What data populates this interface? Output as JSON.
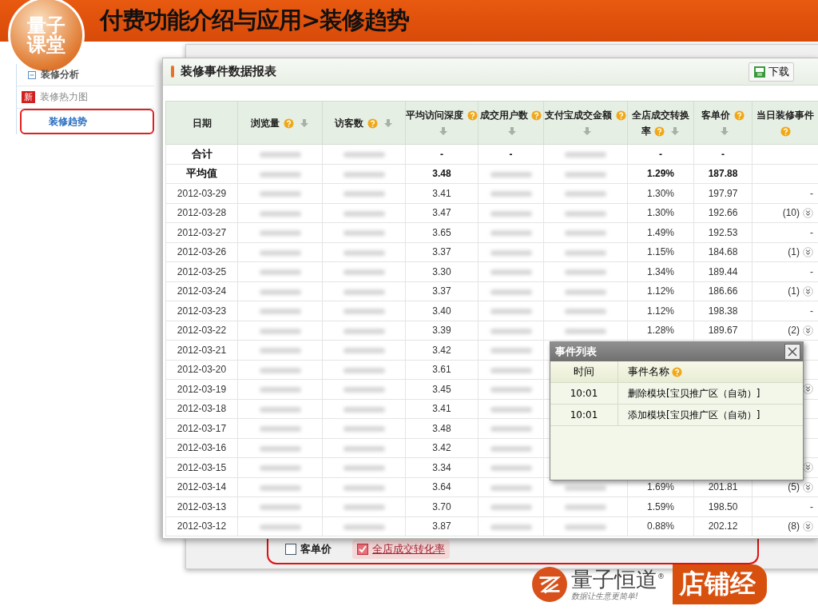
{
  "slide": {
    "title": "付费功能介绍与应用>装修趋势",
    "logo": [
      "量子",
      "课堂"
    ]
  },
  "sidebar": {
    "items": [
      {
        "kind": "group",
        "label": "装修分析",
        "selected": false
      },
      {
        "kind": "new",
        "badge": "新",
        "label": "装修热力图",
        "selected": false
      },
      {
        "kind": "link",
        "label": "装修趋势",
        "selected": true
      }
    ]
  },
  "report": {
    "title": "装修事件数据报表",
    "download": "下载",
    "columns": [
      {
        "label": "日期",
        "help": false,
        "sort": false
      },
      {
        "label": "浏览量",
        "help": true,
        "sort": true
      },
      {
        "label": "访客数",
        "help": true,
        "sort": true
      },
      {
        "label": "平均访问深度",
        "help": true,
        "sort": true
      },
      {
        "label": "成交用户数",
        "help": true,
        "sort": true
      },
      {
        "label": "支付宝成交金额",
        "help": true,
        "sort": true
      },
      {
        "label": "全店成交转换率",
        "help": true,
        "sort": true
      },
      {
        "label": "客单价",
        "help": true,
        "sort": true
      },
      {
        "label": "当日装修事件",
        "help": true,
        "sort": false
      }
    ],
    "rows": [
      {
        "kind": "summary",
        "cells": [
          "合计",
          {
            "kind": "blurred"
          },
          {
            "kind": "blurred"
          },
          "-",
          "-",
          {
            "kind": "blurred"
          },
          "-",
          "-",
          null
        ],
        "expandable": false
      },
      {
        "kind": "summary",
        "cells": [
          "平均值",
          {
            "kind": "blurred"
          },
          {
            "kind": "blurred"
          },
          "3.48",
          {
            "kind": "blurred"
          },
          {
            "kind": "blurred"
          },
          "1.29%",
          "187.88",
          null
        ],
        "expandable": false
      },
      {
        "kind": "date",
        "cells": [
          "2012-03-29",
          {
            "kind": "blurred"
          },
          {
            "kind": "blurred"
          },
          "3.41",
          {
            "kind": "blurred"
          },
          {
            "kind": "blurred"
          },
          "1.30%",
          "197.97",
          "-"
        ],
        "expandable": false
      },
      {
        "kind": "date",
        "cells": [
          "2012-03-28",
          {
            "kind": "blurred"
          },
          {
            "kind": "blurred"
          },
          "3.47",
          {
            "kind": "blurred"
          },
          {
            "kind": "blurred"
          },
          "1.30%",
          "192.66",
          "(10)"
        ],
        "expandable": true
      },
      {
        "kind": "date",
        "cells": [
          "2012-03-27",
          {
            "kind": "blurred"
          },
          {
            "kind": "blurred"
          },
          "3.65",
          {
            "kind": "blurred"
          },
          {
            "kind": "blurred"
          },
          "1.49%",
          "192.53",
          "-"
        ],
        "expandable": false
      },
      {
        "kind": "date",
        "cells": [
          "2012-03-26",
          {
            "kind": "blurred"
          },
          {
            "kind": "blurred"
          },
          "3.37",
          {
            "kind": "blurred"
          },
          {
            "kind": "blurred"
          },
          "1.15%",
          "184.68",
          "(1)"
        ],
        "expandable": true
      },
      {
        "kind": "date",
        "cells": [
          "2012-03-25",
          {
            "kind": "blurred"
          },
          {
            "kind": "blurred"
          },
          "3.30",
          {
            "kind": "blurred"
          },
          {
            "kind": "blurred"
          },
          "1.34%",
          "189.44",
          "-"
        ],
        "expandable": false
      },
      {
        "kind": "date",
        "cells": [
          "2012-03-24",
          {
            "kind": "blurred"
          },
          {
            "kind": "blurred"
          },
          "3.37",
          {
            "kind": "blurred"
          },
          {
            "kind": "blurred"
          },
          "1.12%",
          "186.66",
          "(1)"
        ],
        "expandable": true
      },
      {
        "kind": "date",
        "cells": [
          "2012-03-23",
          {
            "kind": "blurred"
          },
          {
            "kind": "blurred"
          },
          "3.40",
          {
            "kind": "blurred"
          },
          {
            "kind": "blurred"
          },
          "1.12%",
          "198.38",
          "-"
        ],
        "expandable": false
      },
      {
        "kind": "date",
        "cells": [
          "2012-03-22",
          {
            "kind": "blurred"
          },
          {
            "kind": "blurred"
          },
          "3.39",
          {
            "kind": "blurred"
          },
          {
            "kind": "blurred"
          },
          "1.28%",
          "189.67",
          "(2)"
        ],
        "expandable": true
      },
      {
        "kind": "date",
        "cells": [
          "2012-03-21",
          {
            "kind": "blurred"
          },
          {
            "kind": "blurred"
          },
          "3.42",
          {
            "kind": "blurred"
          },
          null,
          null,
          null,
          null
        ],
        "expandable": false
      },
      {
        "kind": "date",
        "cells": [
          "2012-03-20",
          {
            "kind": "blurred"
          },
          {
            "kind": "blurred"
          },
          "3.61",
          {
            "kind": "blurred"
          },
          null,
          null,
          null,
          null
        ],
        "expandable": false
      },
      {
        "kind": "date",
        "cells": [
          "2012-03-19",
          {
            "kind": "blurred"
          },
          {
            "kind": "blurred"
          },
          "3.45",
          {
            "kind": "blurred"
          },
          null,
          null,
          null,
          null
        ],
        "expandable": true
      },
      {
        "kind": "date",
        "cells": [
          "2012-03-18",
          {
            "kind": "blurred"
          },
          {
            "kind": "blurred"
          },
          "3.41",
          {
            "kind": "blurred"
          },
          null,
          null,
          null,
          null
        ],
        "expandable": false
      },
      {
        "kind": "date",
        "cells": [
          "2012-03-17",
          {
            "kind": "blurred"
          },
          {
            "kind": "blurred"
          },
          "3.48",
          {
            "kind": "blurred"
          },
          null,
          null,
          null,
          null
        ],
        "expandable": false
      },
      {
        "kind": "date",
        "cells": [
          "2012-03-16",
          {
            "kind": "blurred"
          },
          {
            "kind": "blurred"
          },
          "3.42",
          {
            "kind": "blurred"
          },
          null,
          null,
          null,
          null
        ],
        "expandable": false
      },
      {
        "kind": "date",
        "cells": [
          "2012-03-15",
          {
            "kind": "blurred"
          },
          {
            "kind": "blurred"
          },
          "3.34",
          {
            "kind": "blurred"
          },
          null,
          null,
          null,
          null
        ],
        "expandable": true
      },
      {
        "kind": "date",
        "cells": [
          "2012-03-14",
          {
            "kind": "blurred"
          },
          {
            "kind": "blurred"
          },
          "3.64",
          {
            "kind": "blurred"
          },
          {
            "kind": "blurred"
          },
          "1.69%",
          "201.81",
          "(5)"
        ],
        "expandable": true
      },
      {
        "kind": "date",
        "cells": [
          "2012-03-13",
          {
            "kind": "blurred"
          },
          {
            "kind": "blurred"
          },
          "3.70",
          {
            "kind": "blurred"
          },
          {
            "kind": "blurred"
          },
          "1.59%",
          "198.50",
          "-"
        ],
        "expandable": false
      },
      {
        "kind": "date",
        "cells": [
          "2012-03-12",
          {
            "kind": "blurred"
          },
          {
            "kind": "blurred"
          },
          "3.87",
          {
            "kind": "blurred"
          },
          {
            "kind": "blurred"
          },
          "0.88%",
          "202.12",
          "(8)"
        ],
        "expandable": true
      }
    ]
  },
  "event_popup": {
    "title": "事件列表",
    "columns": [
      "时间",
      "事件名称"
    ],
    "rows": [
      {
        "time": "10:01",
        "name": "删除模块[宝贝推广区（自动）]"
      },
      {
        "time": "10:01",
        "name": "添加模块[宝贝推广区（自动）]"
      }
    ]
  },
  "metric_options": [
    {
      "label": "客单价",
      "checked": false
    },
    {
      "label": "全店成交转化率",
      "checked": true
    }
  ],
  "brand": {
    "name": "量子恒道",
    "mark": "®",
    "slogan": "数据让生意更简单!",
    "product": "店铺经"
  }
}
